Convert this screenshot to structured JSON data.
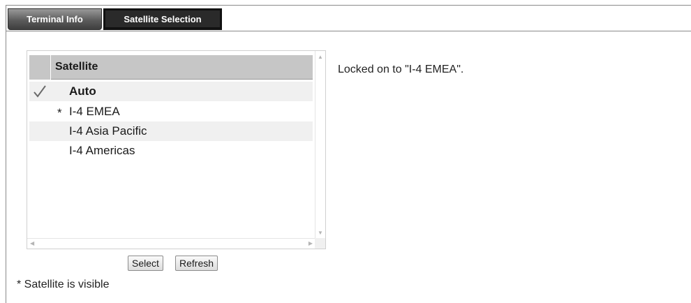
{
  "tabs": {
    "terminal_info": "Terminal Info",
    "satellite_selection": "Satellite Selection"
  },
  "satellite_list": {
    "header": "Satellite",
    "rows": [
      {
        "mark": "",
        "name": "Auto",
        "checked": true
      },
      {
        "mark": "*",
        "name": "I-4 EMEA",
        "checked": false
      },
      {
        "mark": "",
        "name": "I-4 Asia Pacific",
        "checked": false
      },
      {
        "mark": "",
        "name": "I-4 Americas",
        "checked": false
      }
    ]
  },
  "buttons": {
    "select": "Select",
    "refresh": "Refresh"
  },
  "status": "Locked on to \"I-4 EMEA\".",
  "footnote": "* Satellite is visible",
  "icons": {
    "checkmark": "checkmark-icon",
    "scroll_up": "scroll-up-arrow-icon",
    "scroll_down": "scroll-down-arrow-icon",
    "scroll_left": "scroll-left-arrow-icon",
    "scroll_right": "scroll-right-arrow-icon"
  }
}
